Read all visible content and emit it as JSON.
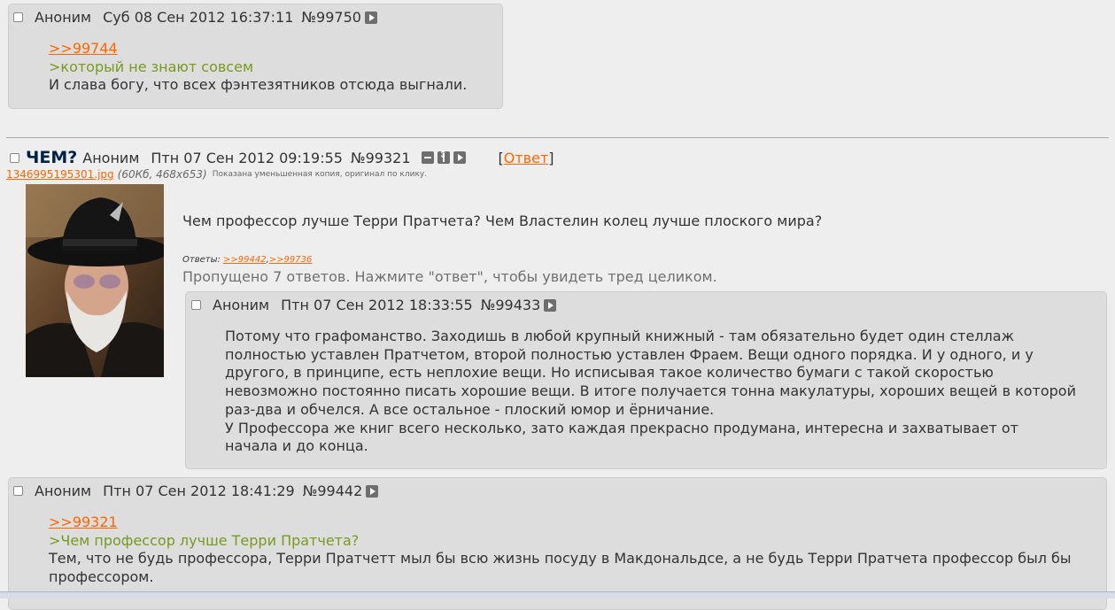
{
  "post1": {
    "name": "Аноним",
    "date": "Суб 08 Сен 2012 16:37:11",
    "num": "№99750",
    "reflink": ">>99744",
    "quote": ">который не знают совсем",
    "text": "И слава богу, что всех фэнтезятников отсюда выгнали."
  },
  "op": {
    "subject": "ЧЕМ?",
    "name": "Аноним",
    "date": "Птн 07 Сен 2012 09:19:55",
    "num": "№99321",
    "reply_open": "[",
    "reply_label": "Ответ",
    "reply_close": "]",
    "file_name": "1346995195301.jpg",
    "file_info": "(60Кб, 468x653)",
    "file_note": "Показана уменьшенная копия, оригинал по клику.",
    "text": "Чем профессор лучше Терри Пратчета? Чем Властелин колец лучше плоского мира?",
    "replies_label": "Ответы:",
    "reply1": ">>99442",
    "reply_sep": ",",
    "reply2": ">>99736",
    "omitted": "Пропущено 7 ответов. Нажмите \"ответ\", чтобы увидеть тред целиком."
  },
  "post2": {
    "name": "Аноним",
    "date": "Птн 07 Сен 2012 18:33:55",
    "num": "№99433",
    "lines": [
      "Потому что графоманство. Заходишь в любой крупный книжный - там обязательно будет один стеллаж",
      "полностью уставлен Пратчетом, второй полностью уставлен Фраем. Вещи одного порядка. И у одного, и у",
      "другого, в принципе, есть неплохие вещи. Но исписывая такое количество бумаги с такой скоростью",
      "невозможно постоянно писать хорошие вещи. В итоге получается тонна макулатуры, хороших вещей в которой",
      "раз-два и обчелся. А все остальное - плоский юмор и ёрничание.",
      "У Профессора же книг всего несколько, зато каждая прекрасно продумана, интересна и захватывает от",
      "начала и до конца."
    ]
  },
  "post3": {
    "name": "Аноним",
    "date": "Птн 07 Сен 2012 18:41:29",
    "num": "№99442",
    "reflink": ">>99321",
    "quote": ">Чем профессор лучше Терри Пратчета?",
    "line1": "Тем, что не будь профессора, Терри Пратчетт мыл бы всю жизнь посуду в Макдональдсе, а не будь Терри Пратчета профессор был бы",
    "line2": "профессором."
  },
  "colors": {
    "background": "#eeeeee",
    "post_bg": "#dddddd",
    "link": "#ff6600",
    "quote": "#789922",
    "subject": "#002244"
  }
}
